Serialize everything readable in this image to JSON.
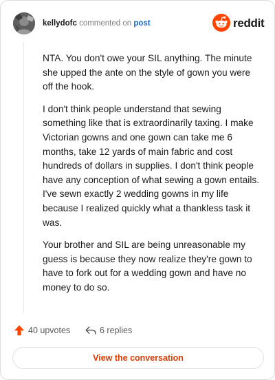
{
  "header": {
    "username": "kellydofc",
    "action_text": "commented on",
    "post_link_text": "post",
    "brand_text": "reddit",
    "brand_icon": "reddit-logo-icon",
    "avatar_icon": "user-avatar"
  },
  "comment": {
    "paragraphs": [
      "NTA. You don't owe your SIL anything. The minute she upped the ante on the style of gown you were off the hook.",
      "I don't think people understand that sewing something like that is extraordinarily taxing. I make Victorian gowns and one gown can take me 6 months, take 12 yards of main fabric and cost hundreds of dollars in supplies. I don't think people have any conception of what sewing a gown entails. I've sewn exactly 2 wedding gowns in my life because I realized quickly what a thankless task it was.",
      "Your brother and SIL are being unreasonable my guess is because they now realize they're gown to have to fork out for a wedding gown and have no money to do so."
    ]
  },
  "stats": {
    "upvotes": "40 upvotes",
    "replies": "6 replies",
    "upvote_icon": "upvote-arrow-icon",
    "reply_icon": "reply-arrow-icon"
  },
  "cta": {
    "label": "View the conversation"
  },
  "colors": {
    "brand_orange": "#ff4500",
    "link_blue": "#1a66c4",
    "cta_text": "#d93a00",
    "muted": "#7c7c7c"
  }
}
